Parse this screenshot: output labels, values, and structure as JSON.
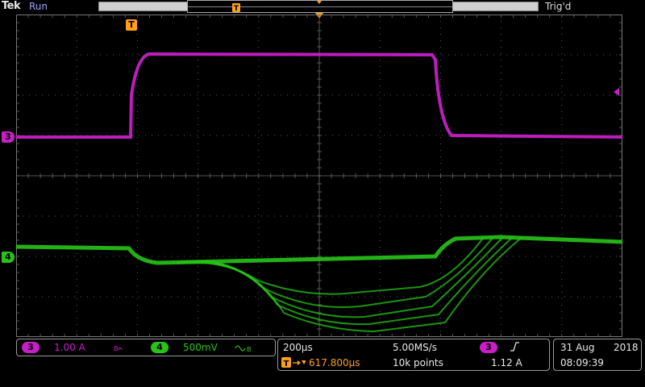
{
  "header": {
    "brand": "Tek",
    "run_state": "Run",
    "trigger_status": "Trig'd",
    "trigger_marker_label": "T"
  },
  "channels": {
    "ch3": {
      "id": "3",
      "scale": "1.00 A",
      "bw_icon": "bw-limit-icon",
      "color": "#c71fc7"
    },
    "ch4": {
      "id": "4",
      "scale": "500mV",
      "coupling_icon": "ac-coupling-icon",
      "color": "#27c417"
    }
  },
  "timebase": {
    "horizontal_scale": "200µs",
    "sample_rate": "5.00MS/s",
    "record_length": "10k points",
    "trigger_position": "617.800µs"
  },
  "trigger": {
    "source": "3",
    "slope_icon": "rising-edge-icon",
    "level": "1.12 A"
  },
  "datetime": {
    "day_month": "31 Aug",
    "year": "2018",
    "time": "08:09:39"
  },
  "colors": {
    "ch3": "#c71fc7",
    "ch4": "#27c417",
    "trigger": "#ff9f1a",
    "grid": "#5a5a5a"
  }
}
